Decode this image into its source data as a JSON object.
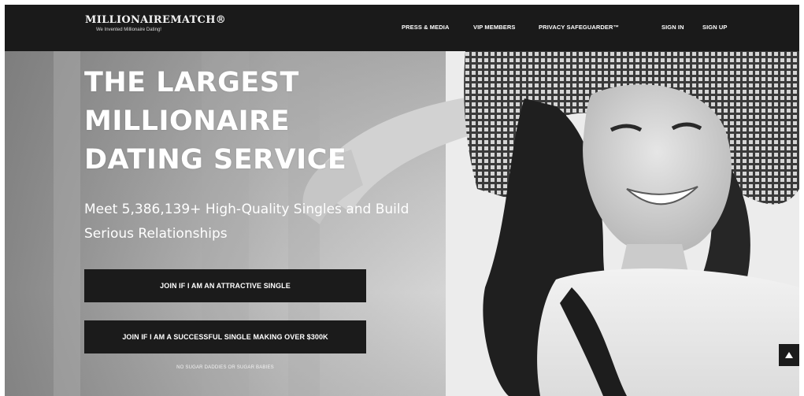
{
  "header": {
    "brand": "MILLIONAIREMATCH®",
    "tagline": "We Invented Millionaire Dating!",
    "nav": [
      {
        "label": "PRESS & MEDIA"
      },
      {
        "label": "VIP MEMBERS"
      },
      {
        "label": "PRIVACY SAFEGUARDER™"
      },
      {
        "label": "SIGN IN"
      },
      {
        "label": "SIGN UP"
      }
    ]
  },
  "hero": {
    "headline": "THE LARGEST MILLIONAIRE DATING SERVICE",
    "subline": "Meet 5,386,139+ High-Quality Singles and Build Serious Relationships",
    "buttons": [
      {
        "label": "JOIN IF I AM AN ATTRACTIVE SINGLE"
      },
      {
        "label": "JOIN IF I AM A SUCCESSFUL SINGLE MAKING OVER $300K"
      }
    ],
    "disclaimer": "NO SUGAR DADDIES OR SUGAR BABIES"
  },
  "icons": {
    "scroll_top": "arrow-up-icon",
    "hero_photo": "smiling-woman-in-sun-hat-photo"
  }
}
